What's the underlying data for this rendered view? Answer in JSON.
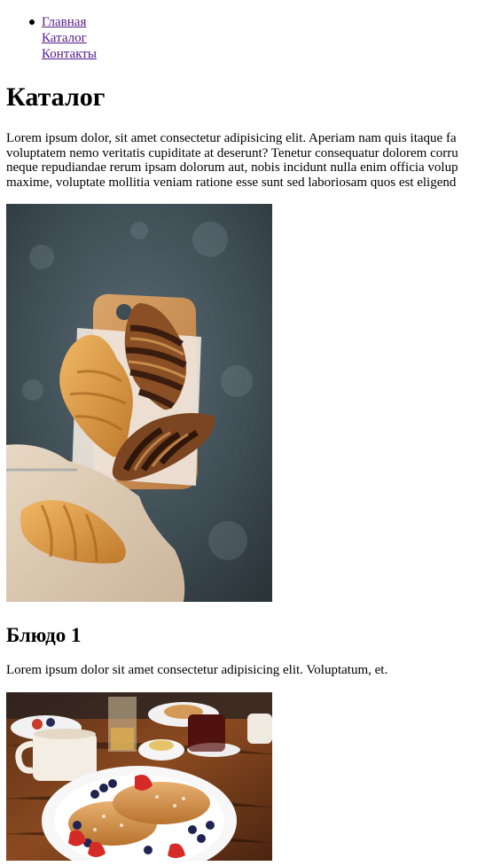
{
  "nav": {
    "items": [
      {
        "label": "Главная"
      },
      {
        "label": "Каталог"
      },
      {
        "label": "Контакты"
      }
    ]
  },
  "page": {
    "title": "Каталог",
    "intro_lines": [
      "Lorem ipsum dolor, sit amet consectetur adipisicing elit. Aperiam nam quis itaque fa",
      "voluptatem nemo veritatis cupiditate at deserunt? Tenetur consequatur dolorem corru",
      "neque repudiandae rerum ipsam dolorum aut, nobis incidunt nulla enim officia volup",
      "maxime, voluptate mollitia veniam ratione esse sunt sed laboriosam quos est eligend"
    ]
  },
  "dishes": [
    {
      "title": "Блюдо 1",
      "description": "Lorem ipsum dolor sit amet consectetur adipisicing elit. Voluptatum, et.",
      "image": "croissants-photo"
    },
    {
      "image": "pancakes-photo"
    }
  ]
}
